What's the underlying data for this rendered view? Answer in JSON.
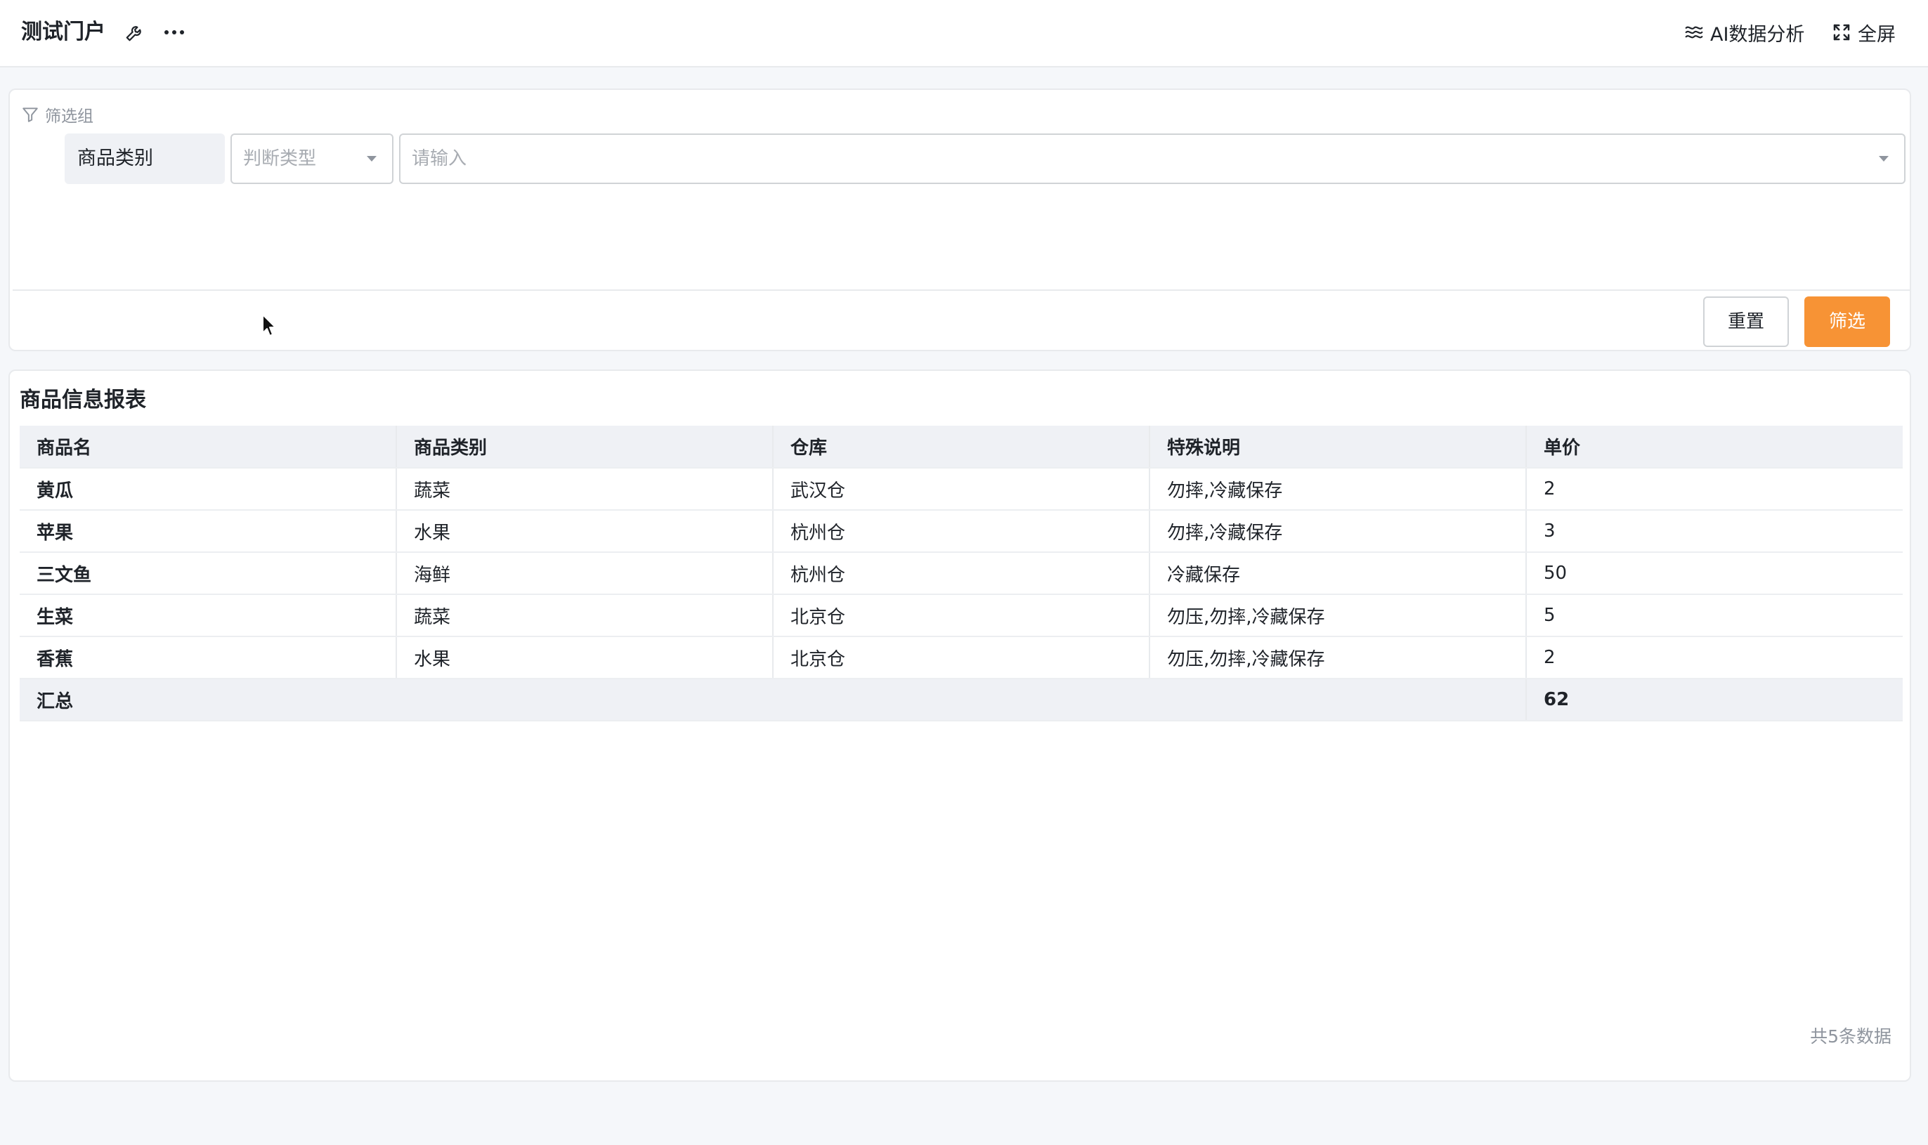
{
  "header": {
    "title": "测试门户",
    "ai_label": "AI数据分析",
    "fullscreen_label": "全屏"
  },
  "filter": {
    "group_label": "筛选组",
    "field_name": "商品类别",
    "operator_placeholder": "判断类型",
    "value_placeholder": "请输入",
    "reset_label": "重置",
    "submit_label": "筛选"
  },
  "report": {
    "title": "商品信息报表",
    "columns": [
      "商品名",
      "商品类别",
      "仓库",
      "特殊说明",
      "单价"
    ],
    "rows": [
      [
        "黄瓜",
        "蔬菜",
        "武汉仓",
        "勿摔,冷藏保存",
        "2"
      ],
      [
        "苹果",
        "水果",
        "杭州仓",
        "勿摔,冷藏保存",
        "3"
      ],
      [
        "三文鱼",
        "海鲜",
        "杭州仓",
        "冷藏保存",
        "50"
      ],
      [
        "生菜",
        "蔬菜",
        "北京仓",
        "勿压,勿摔,冷藏保存",
        "5"
      ],
      [
        "香蕉",
        "水果",
        "北京仓",
        "勿压,勿摔,冷藏保存",
        "2"
      ]
    ],
    "summary_label": "汇总",
    "summary_value": "62",
    "record_count": "共5条数据"
  },
  "colors": {
    "accent": "#f79335",
    "header_bg": "#eff1f5"
  }
}
